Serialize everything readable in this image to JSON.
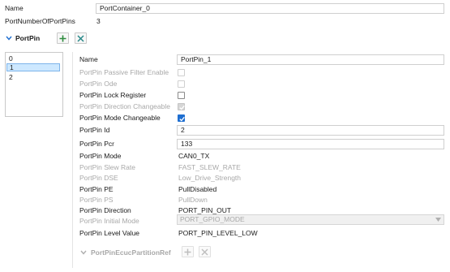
{
  "header": {
    "name_label": "Name",
    "name_value": "PortContainer_0",
    "num_pins_label": "PortNumberOfPortPins",
    "num_pins_value": "3"
  },
  "section": {
    "title": "PortPin",
    "add_icon": "plus-icon",
    "remove_icon": "x-icon"
  },
  "pin_list": [
    "0",
    "1",
    "2"
  ],
  "selected_index": 1,
  "fields": {
    "name": {
      "label": "Name",
      "value": "PortPin_1"
    },
    "passive_filter": {
      "label": "PortPin Passive Filter Enable"
    },
    "ode": {
      "label": "PortPin Ode"
    },
    "lock_register": {
      "label": "PortPin Lock Register"
    },
    "direction_changeable": {
      "label": "PortPin Direction Changeable"
    },
    "mode_changeable": {
      "label": "PortPin Mode Changeable"
    },
    "pin_id": {
      "label": "PortPin Id",
      "value": "2"
    },
    "pin_pcr": {
      "label": "PortPin Pcr",
      "value": "133"
    },
    "pin_mode": {
      "label": "PortPin Mode",
      "value": "CAN0_TX"
    },
    "slew_rate": {
      "label": "PortPin Slew Rate",
      "value": "FAST_SLEW_RATE"
    },
    "dse": {
      "label": "PortPin DSE",
      "value": "Low_Drive_Strength"
    },
    "pe": {
      "label": "PortPin PE",
      "value": "PullDisabled"
    },
    "ps": {
      "label": "PortPin PS",
      "value": "PullDown"
    },
    "direction": {
      "label": "PortPin Direction",
      "value": "PORT_PIN_OUT"
    },
    "initial_mode": {
      "label": "PortPin Initial Mode",
      "value": "PORT_GPIO_MODE"
    },
    "level_value": {
      "label": "PortPin Level Value",
      "value": "PORT_PIN_LEVEL_LOW"
    }
  },
  "partition_ref": {
    "label": "PortPinEcucPartitionRef"
  },
  "colors": {
    "accent": "#1f6fd1",
    "add_green": "#2e8b3e",
    "remove_teal": "#2a8a8a",
    "disabled_text": "#a8a8a8"
  }
}
